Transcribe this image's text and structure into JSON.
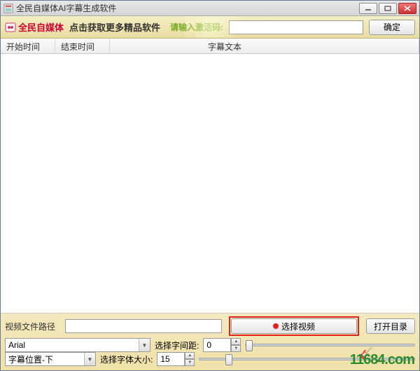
{
  "window": {
    "title": "全民自媒体AI字幕生成软件"
  },
  "toolbar": {
    "brand": "全民自媒体",
    "banner": "点击获取更多精品软件",
    "code_label": "请输入激活码:",
    "code_value": "",
    "confirm_label": "确定"
  },
  "table": {
    "columns": [
      "开始时间",
      "结束时间",
      "字幕文本"
    ],
    "rows": []
  },
  "bottom": {
    "path_label": "视频文件路径",
    "path_value": "",
    "select_video_label": "选择视频",
    "open_dir_label": "打开目录",
    "font_dropdown": "Arial",
    "spacing_label": "选择字间距:",
    "spacing_value": "0",
    "position_dropdown": "字幕位置-下",
    "fontsize_label": "选择字体大小:",
    "fontsize_value": "15"
  },
  "watermark": "11684.com"
}
